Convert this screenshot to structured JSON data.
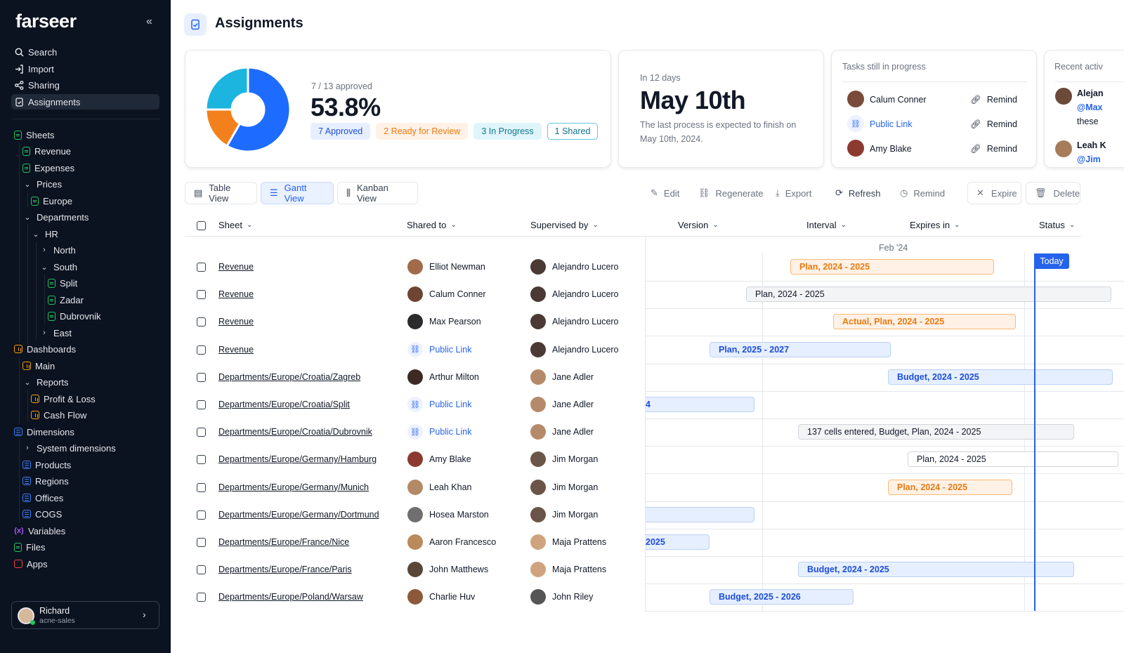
{
  "app": {
    "logo": "farseer"
  },
  "sidebar": {
    "top_items": [
      {
        "label": "Search",
        "icon": "search-icon"
      },
      {
        "label": "Import",
        "icon": "import-icon"
      },
      {
        "label": "Sharing",
        "icon": "share-icon"
      },
      {
        "label": "Assignments",
        "icon": "assignments-icon",
        "active": true
      }
    ],
    "tree": {
      "sheets": "Sheets",
      "revenue": "Revenue",
      "expenses": "Expenses",
      "prices": "Prices",
      "europe": "Europe",
      "departments": "Departments",
      "hr": "HR",
      "north": "North",
      "south": "South",
      "split": "Split",
      "zadar": "Zadar",
      "dubrovnik": "Dubrovnik",
      "east": "East",
      "dashboards": "Dashboards",
      "main": "Main",
      "reports": "Reports",
      "profit_loss": "Profit & Loss",
      "cash_flow": "Cash Flow",
      "dimensions": "Dimensions",
      "system_dimensions": "System dimensions",
      "products": "Products",
      "regions": "Regions",
      "offices": "Offices",
      "cogs": "COGS",
      "variables": "Variables",
      "files": "Files",
      "apps": "Apps"
    },
    "user": {
      "name": "Richard",
      "org": "acne-sales"
    }
  },
  "page": {
    "title": "Assignments"
  },
  "summary": {
    "approved_count": "7 / 13 approved",
    "percent": "53.8%",
    "pills": {
      "approved": "7 Approved",
      "review": "2 Ready for Review",
      "progress": "3 In Progress",
      "shared": "1 Shared"
    },
    "pie": [
      {
        "label": "Approved",
        "value": 7,
        "color": "#1e6bff"
      },
      {
        "label": "Ready for Review",
        "value": 2,
        "color": "#f2811d"
      },
      {
        "label": "In Progress",
        "value": 3,
        "color": "#1cb5e0"
      }
    ]
  },
  "deadline": {
    "lead": "In 12 days",
    "date": "May 10th",
    "desc": "The last process is expected to finish on May 10th, 2024."
  },
  "tasks": {
    "title": "Tasks still in progress",
    "items": [
      {
        "name": "Calum Conner",
        "action": "Remind",
        "link": false
      },
      {
        "name": "Public Link",
        "action": "Remind",
        "link": true
      },
      {
        "name": "Amy Blake",
        "action": "Remind",
        "link": false
      }
    ]
  },
  "activity": {
    "title": "Recent activ",
    "items": [
      {
        "name": "Alejan",
        "mention": "@Max",
        "text": "these"
      },
      {
        "name": "Leah K",
        "mention": "@Jim",
        "text": ""
      }
    ]
  },
  "views": {
    "table": "Table View",
    "gantt": "Gantt View",
    "kanban": "Kanban View"
  },
  "toolbar": {
    "edit": "Edit",
    "regenerate": "Regenerate",
    "export": "Export",
    "refresh": "Refresh",
    "remind": "Remind",
    "expire": "Expire",
    "delete": "Delete"
  },
  "columns": {
    "sheet": "Sheet",
    "shared_to": "Shared to",
    "supervised_by": "Supervised by",
    "version": "Version",
    "interval": "Interval",
    "expires_in": "Expires in",
    "status": "Status"
  },
  "gantt": {
    "month": "Feb '24",
    "today": "Today"
  },
  "rows": [
    {
      "sheet": "Revenue",
      "shared": "Elliot Newman",
      "supervisor": "Alejandro Lucero",
      "bar": "Plan, 2024 - 2025"
    },
    {
      "sheet": "Revenue",
      "shared": "Calum Conner",
      "supervisor": "Alejandro Lucero",
      "bar": "Plan, 2024 - 2025"
    },
    {
      "sheet": "Revenue",
      "shared": "Max Pearson",
      "supervisor": "Alejandro Lucero",
      "bar": "Actual, Plan, 2024 - 2025"
    },
    {
      "sheet": "Revenue",
      "shared": "Public Link",
      "supervisor": "Alejandro Lucero",
      "bar": "Plan, 2025 - 2027"
    },
    {
      "sheet": "Departments/Europe/Croatia/Zagreb",
      "shared": "Arthur Milton",
      "supervisor": "Jane Adler",
      "bar": "Budget, 2024 - 2025"
    },
    {
      "sheet": "Departments/Europe/Croatia/Split",
      "shared": "Public Link",
      "supervisor": "Jane Adler",
      "bar": "4"
    },
    {
      "sheet": "Departments/Europe/Croatia/Dubrovnik",
      "shared": "Public Link",
      "supervisor": "Jane Adler",
      "bar": "137 cells entered, Budget, Plan, 2024 - 2025"
    },
    {
      "sheet": "Departments/Europe/Germany/Hamburg",
      "shared": "Amy Blake",
      "supervisor": "Jim Morgan",
      "bar": "Plan, 2024 - 2025"
    },
    {
      "sheet": "Departments/Europe/Germany/Munich",
      "shared": "Leah Khan",
      "supervisor": "Jim Morgan",
      "bar": "Plan, 2024 - 2025"
    },
    {
      "sheet": "Departments/Europe/Germany/Dortmund",
      "shared": "Hosea Marston",
      "supervisor": "Jim Morgan",
      "bar": ""
    },
    {
      "sheet": "Departments/Europe/France/Nice",
      "shared": "Aaron Francesco",
      "supervisor": "Maja Prattens",
      "bar": "2025"
    },
    {
      "sheet": "Departments/Europe/France/Paris",
      "shared": "John Matthews",
      "supervisor": "Maja Prattens",
      "bar": "Budget, 2024 - 2025"
    },
    {
      "sheet": "Departments/Europe/Poland/Warsaw",
      "shared": "Charlie Huv",
      "supervisor": "John Riley",
      "bar": "Budget, 2025 - 2026"
    }
  ]
}
